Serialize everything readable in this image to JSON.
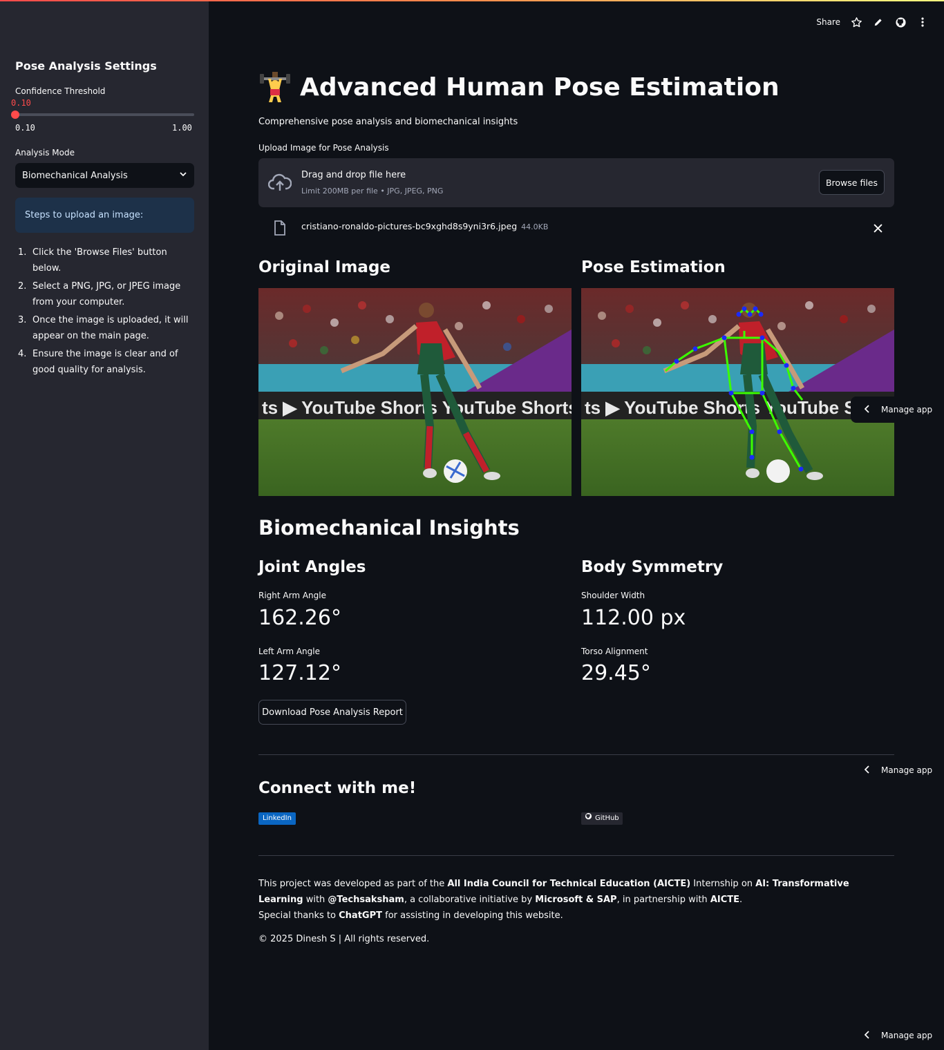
{
  "sidebar": {
    "title": "Pose Analysis Settings",
    "confidence": {
      "label": "Confidence Threshold",
      "value": "0.10",
      "min": "0.10",
      "max": "1.00",
      "fraction": 0
    },
    "analysis_mode": {
      "label": "Analysis Mode",
      "selected": "Biomechanical Analysis"
    },
    "info": "Steps to upload an image:",
    "steps": [
      {
        "num": "1.",
        "text": "Click the 'Browse Files' button below."
      },
      {
        "num": "2.",
        "text": "Select a PNG, JPG, or JPEG image from your computer."
      },
      {
        "num": "3.",
        "text": "Once the image is uploaded, it will appear on the main page."
      },
      {
        "num": "4.",
        "text": "Ensure the image is clear and of good quality for analysis."
      }
    ]
  },
  "toolbar": {
    "share": "Share",
    "icons": [
      "star-icon",
      "pencil-icon",
      "github-icon",
      "more-icon"
    ]
  },
  "main": {
    "title": "Advanced Human Pose Estimation",
    "title_emoji": "weightlifter-emoji",
    "subtitle": "Comprehensive pose analysis and biomechanical insights",
    "upload": {
      "label": "Upload Image for Pose Analysis",
      "drag_text": "Drag and drop file here",
      "limit_text": "Limit 200MB per file • JPG, JPEG, PNG",
      "browse_label": "Browse files",
      "file_name": "cristiano-ronaldo-pictures-bc9xghd8s9yni3r6.jpeg",
      "file_size": "44.0KB"
    },
    "original_heading": "Original Image",
    "pose_heading": "Pose Estimation",
    "insights_heading": "Biomechanical Insights",
    "joint_angles": {
      "heading": "Joint Angles",
      "right_arm_label": "Right Arm Angle",
      "right_arm_value": "162.26°",
      "left_arm_label": "Left Arm Angle",
      "left_arm_value": "127.12°"
    },
    "body_symmetry": {
      "heading": "Body Symmetry",
      "shoulder_label": "Shoulder Width",
      "shoulder_value": "112.00 px",
      "torso_label": "Torso Alignment",
      "torso_value": "29.45°"
    },
    "download_label": "Download Pose Analysis Report",
    "manage_app": "Manage app",
    "connect_heading": "Connect with me!",
    "linkedin": "LinkedIn",
    "github": "GitHub",
    "footer": {
      "p1_a": "This project was developed as part of the ",
      "p1_b": "All India Council for Technical Education (AICTE)",
      "p1_c": " Internship on ",
      "p1_d": "AI: Transformative Learning",
      "p1_e": " with ",
      "p1_f": "@Techsaksham",
      "p1_g": ", a collaborative initiative by ",
      "p1_h": "Microsoft & SAP",
      "p1_i": ", in partnership with ",
      "p1_j": "AICTE",
      "p1_k": ".",
      "p2_a": "Special thanks to ",
      "p2_b": "ChatGPT",
      "p2_c": " for assisting in developing this website.",
      "copyright": "© 2025 Dinesh S | All rights reserved."
    }
  },
  "colors": {
    "accent": "#ff4b4b",
    "background": "#0e1117",
    "sidebar": "#262730",
    "info_box": "#1d3149",
    "skeleton_line": "#3cff00",
    "skeleton_joint": "#0000ff"
  }
}
